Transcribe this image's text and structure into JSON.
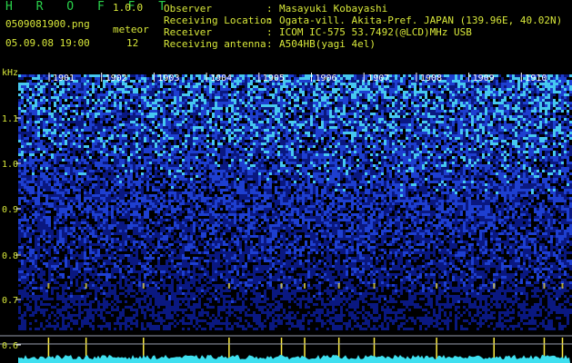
{
  "app": {
    "title": "H R O F F T",
    "version": "1.0.0",
    "file_name": "0509081900.png",
    "date_time": "05.09.08 19:00",
    "meteor_label": "meteor",
    "meteor_count": "12"
  },
  "info": [
    {
      "key": "Observer",
      "value": "Masayuki Kobayashi"
    },
    {
      "key": "Receiving Location",
      "value": "Ogata-vill. Akita-Pref. JAPAN (139.96E, 40.02N)"
    },
    {
      "key": "Receiver",
      "value": "ICOM IC-575 53.7492(@LCD)MHz USB"
    },
    {
      "key": "Receiving antenna",
      "value": "A504HB(yagi 4el)"
    }
  ],
  "chart_data": {
    "type": "heatmap",
    "ylabel": "kHz",
    "y_ticks": [
      "1.1",
      "1.0",
      "0.9",
      "0.8",
      "0.7",
      "0.6"
    ],
    "x_ticks": [
      "1901",
      "1902",
      "1903",
      "1904",
      "1905",
      "1906",
      "1907",
      "1908",
      "1909",
      "1910"
    ],
    "meteor_minutes": [
      5.5,
      12.3,
      22.7,
      38.2,
      47.7,
      51.9,
      58.1,
      64.5,
      75.8,
      86.2,
      95.3,
      98.6
    ],
    "colors": {
      "background": "#000000",
      "noise_low": "#0a1880",
      "noise_mid": "#1e3fd0",
      "noise_high": "#46c8f0",
      "trace": "#3fe0f0",
      "meteor": "#ffee44",
      "grid": "#ffffff"
    }
  }
}
